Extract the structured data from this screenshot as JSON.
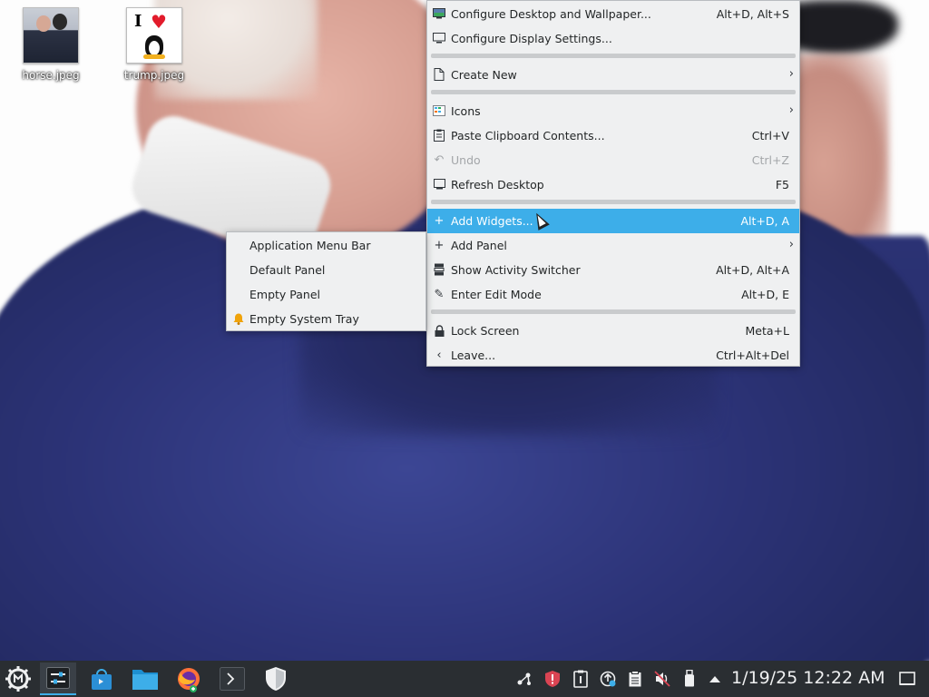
{
  "desktop": {
    "icons": [
      {
        "label": "horse.jpeg",
        "icon": "image-thumbnail-icon"
      },
      {
        "label": "trump.jpeg",
        "icon": "image-thumbnail-icon"
      }
    ],
    "trump_thumb_text": "I"
  },
  "context_menu": {
    "items": [
      {
        "label": "Configure Desktop and Wallpaper...",
        "shortcut": "Alt+D, Alt+S",
        "icon": "desktop-config-icon"
      },
      {
        "label": "Configure Display Settings...",
        "shortcut": "",
        "icon": "monitor-icon"
      },
      {
        "label": "Create New",
        "shortcut": "",
        "icon": "new-document-icon",
        "submenu": true
      },
      {
        "label": "Icons",
        "shortcut": "",
        "icon": "grid-icon",
        "submenu": true
      },
      {
        "label": "Paste Clipboard Contents...",
        "shortcut": "Ctrl+V",
        "icon": "clipboard-icon"
      },
      {
        "label": "Undo",
        "shortcut": "Ctrl+Z",
        "icon": "undo-icon",
        "disabled": true
      },
      {
        "label": "Refresh Desktop",
        "shortcut": "F5",
        "icon": "refresh-icon"
      },
      {
        "label": "Add Widgets...",
        "shortcut": "Alt+D, A",
        "icon": "plus-icon",
        "highlighted": true
      },
      {
        "label": "Add Panel",
        "shortcut": "",
        "icon": "plus-icon",
        "submenu": true
      },
      {
        "label": "Show Activity Switcher",
        "shortcut": "Alt+D, Alt+A",
        "icon": "activities-icon"
      },
      {
        "label": "Enter Edit Mode",
        "shortcut": "Alt+D, E",
        "icon": "pencil-icon"
      },
      {
        "label": "Lock Screen",
        "shortcut": "Meta+L",
        "icon": "lock-icon"
      },
      {
        "label": "Leave...",
        "shortcut": "Ctrl+Alt+Del",
        "icon": "leave-icon"
      }
    ]
  },
  "add_panel_submenu": {
    "items": [
      {
        "label": "Application Menu Bar"
      },
      {
        "label": "Default Panel"
      },
      {
        "label": "Empty Panel"
      },
      {
        "label": "Empty System Tray",
        "icon": "bell-icon"
      }
    ]
  },
  "taskbar": {
    "apps": [
      "system-settings",
      "discover",
      "dolphin-file-manager",
      "firefox",
      "konsole-terminal",
      "security-shield"
    ],
    "tray": [
      "kde-connect",
      "shield-alert",
      "clipboard-info",
      "updates",
      "clipboard",
      "volume-muted",
      "usb-device",
      "show-hidden"
    ],
    "clock": "1/19/25 12:22 AM"
  },
  "colors": {
    "accent": "#3daee9",
    "panel": "#2a2e32",
    "menu_bg": "#eff0f1"
  }
}
